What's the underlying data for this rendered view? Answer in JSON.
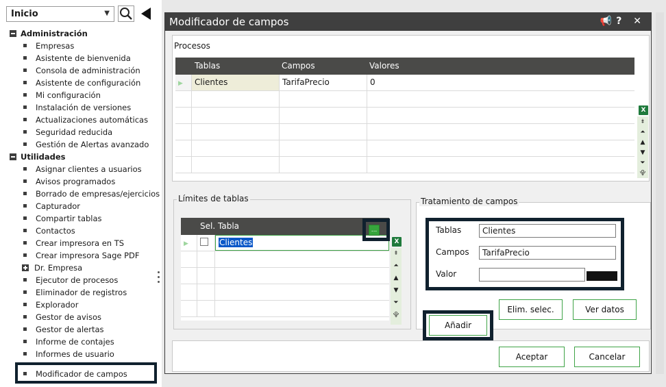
{
  "nav": {
    "home_value": "Inicio",
    "groups": [
      {
        "label": "Administración",
        "items": [
          "Empresas",
          "Asistente de bienvenida",
          "Consola de administración",
          "Asistente de configuración",
          "Mi configuración",
          "Instalación de versiones",
          "Actualizaciones automáticas",
          "Seguridad reducida",
          "Gestión de Alertas avanzado"
        ]
      },
      {
        "label": "Utilidades",
        "items": [
          "Asignar clientes a usuarios",
          "Avisos programados",
          "Borrado de empresas/ejercicios",
          "Capturador",
          "Compartir tablas",
          "Contactos",
          "Crear impresora en TS",
          "Crear impresora Sage PDF",
          "Dr. Empresa",
          "Ejecutor de procesos",
          "Eliminador de registros",
          "Explorador",
          "Gestor de avisos",
          "Gestor de alertas",
          "Informe de contajes",
          "Informes de usuario"
        ]
      }
    ],
    "selected_item": "Modificador de campos"
  },
  "dialog": {
    "title": "Modificador de campos",
    "title_icons": "? ✕",
    "procesos": {
      "label": "Procesos",
      "columns": [
        "Tablas",
        "Campos",
        "Valores"
      ],
      "rows": [
        {
          "tablas": "Clientes",
          "campos": "TarifaPrecio",
          "valores": "0"
        }
      ]
    },
    "limites": {
      "legend": "Límites de tablas",
      "columns": [
        "Sel.",
        "Tabla"
      ],
      "rows": [
        {
          "tabla": "Clientes"
        }
      ],
      "ellipsis": "..."
    },
    "tratamiento": {
      "legend": "Tratamiento de campos",
      "tablas_label": "Tablas",
      "tablas_value": "Clientes",
      "campos_label": "Campos",
      "campos_value": "TarifaPrecio",
      "valor_label": "Valor",
      "valor_value": ""
    },
    "buttons": {
      "add": "Añadir",
      "remove": "Elim. selec.",
      "view": "Ver datos",
      "accept": "Aceptar",
      "cancel": "Cancelar"
    },
    "colors": {
      "accent_green": "#3ea346",
      "header_dark": "#4a4a48",
      "highlight_frame": "#10212e"
    }
  }
}
